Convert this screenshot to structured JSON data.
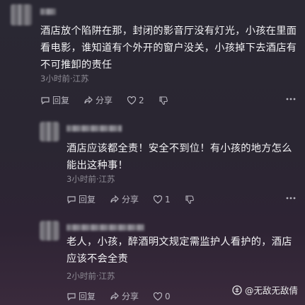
{
  "comments": [
    {
      "text": "酒店放个陷阱在那，封闭的影音厅没有灯光，小孩在里面看电影，谁知道有个外开的窗户没关，小孩掉下去酒店有不可推卸的责任",
      "meta": "3小时前·江苏",
      "reply_label": "回复",
      "share_label": "分享",
      "likes": "2"
    },
    {
      "text": "酒店应该都全责！安全不到位！有小孩的地方怎么能出这种事！",
      "meta": "3小时前·江苏",
      "reply_label": "回复",
      "share_label": "分享",
      "likes": "1"
    },
    {
      "text": "老人，小孩，醉酒明文规定需监护人看护的，酒店应该不会全责",
      "meta": "2小时前·江苏",
      "reply_label": "回复",
      "share_label": "分享",
      "likes": "0"
    }
  ],
  "watermark": "@无敌无敌倩",
  "colors": {
    "background": "#2a2833",
    "text": "#f3f3f5",
    "meta": "#8e8c95"
  }
}
